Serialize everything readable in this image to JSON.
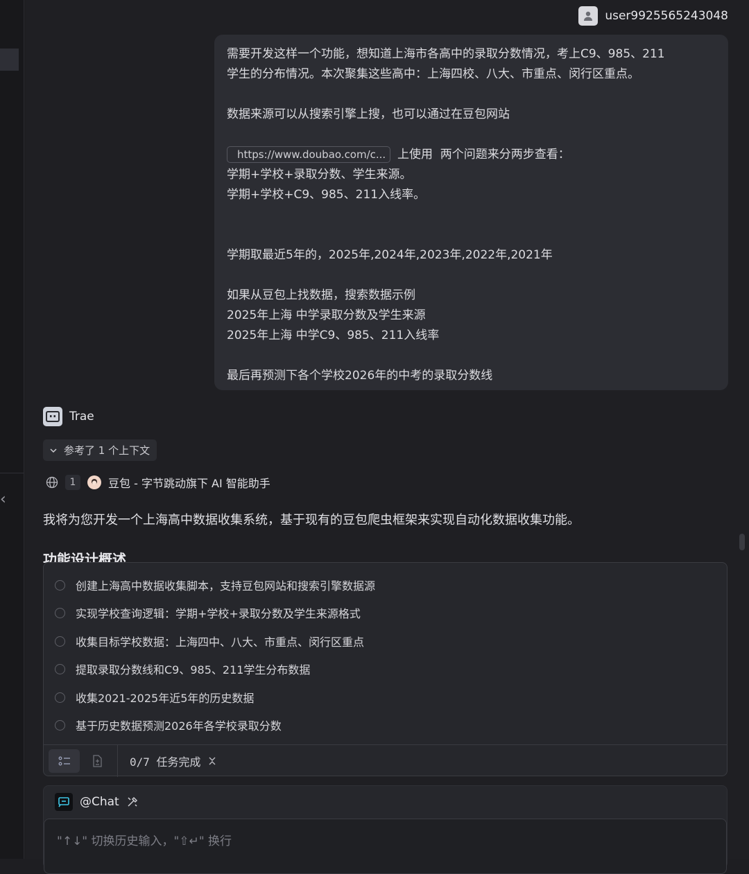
{
  "user": {
    "name": "user9925565243048"
  },
  "message": {
    "line1": "需要开发这样一个功能，想知道上海市各高中的录取分数情况，考上C9、985、211",
    "line2": "学生的分布情况。本次聚集这些高中：上海四校、八大、市重点、闵行区重点。",
    "line3": "数据来源可以从搜索引擎上搜，也可以通过在豆包网站",
    "link_text": "https://www.doubao.com/c...",
    "line4_rest": "上使用  两个问题来分两步查看：",
    "line5": "学期+学校+录取分数、学生来源。",
    "line6": "学期+学校+C9、985、211入线率。",
    "line7": "学期取最近5年的，2025年,2024年,2023年,2022年,2021年",
    "line8": "如果从豆包上找数据，搜索数据示例",
    "line9": "2025年上海 中学录取分数及学生来源",
    "line10": "2025年上海 中学C9、985、211入线率",
    "line11": "最后再预测下各个学校2026年的中考的录取分数线"
  },
  "assistant": {
    "name": "Trae",
    "context_label": "参考了 1 个上下文",
    "ref_count": "1",
    "ref_title": "豆包 - 字节跳动旗下 AI 智能助手",
    "intro": "我将为您开发一个上海高中数据收集系统，基于现有的豆包爬虫框架来实现自动化数据收集功能。",
    "section_heading": "功能设计概述"
  },
  "tasks": {
    "items": [
      "创建上海高中数据收集脚本，支持豆包网站和搜索引擎数据源",
      "实现学校查询逻辑：学期+学校+录取分数及学生来源格式",
      "收集目标学校数据：上海四中、八大、市重点、闵行区重点",
      "提取录取分数线和C9、985、211学生分布数据",
      "收集2021-2025年近5年的历史数据",
      "基于历史数据预测2026年各学校录取分数"
    ],
    "progress": "0/7 任务完成"
  },
  "chat": {
    "mode": "@Chat",
    "placeholder": "\"↑↓\" 切换历史输入，\"⇧↵\" 换行"
  }
}
